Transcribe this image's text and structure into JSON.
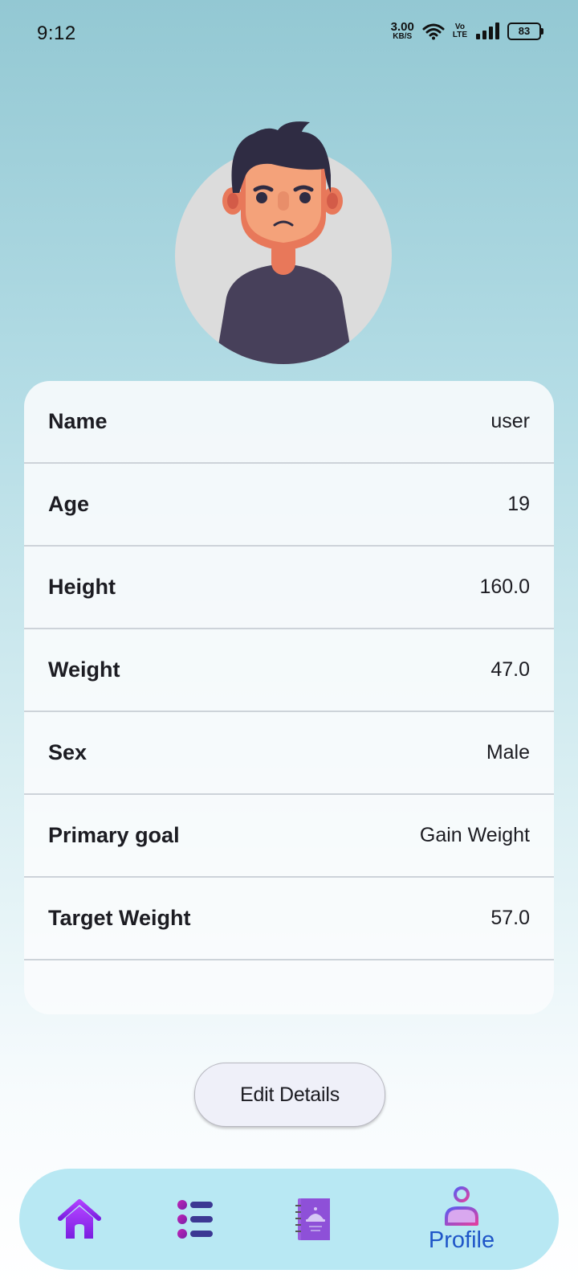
{
  "status_bar": {
    "time": "9:12",
    "net_speed_value": "3.00",
    "net_speed_unit": "KB/S",
    "volte_top": "Vo",
    "volte_bottom": "LTE",
    "battery": "83"
  },
  "profile": {
    "rows": [
      {
        "label": "Name",
        "value": "user"
      },
      {
        "label": "Age",
        "value": "19"
      },
      {
        "label": "Height",
        "value": "160.0"
      },
      {
        "label": "Weight",
        "value": "47.0"
      },
      {
        "label": "Sex",
        "value": "Male"
      },
      {
        "label": "Primary goal",
        "value": "Gain Weight"
      },
      {
        "label": "Target Weight",
        "value": "57.0"
      }
    ]
  },
  "edit_button_label": "Edit Details",
  "bottom_nav": {
    "items": [
      {
        "icon": "home-icon"
      },
      {
        "icon": "list-icon"
      },
      {
        "icon": "recipe-book-icon"
      },
      {
        "icon": "profile-icon",
        "label": "Profile",
        "active": true
      }
    ]
  },
  "colors": {
    "nav_background": "#b8e8f3",
    "active_label": "#1f56c8",
    "home_icon": "#8b2be2",
    "card_background": "#fafcfd"
  }
}
